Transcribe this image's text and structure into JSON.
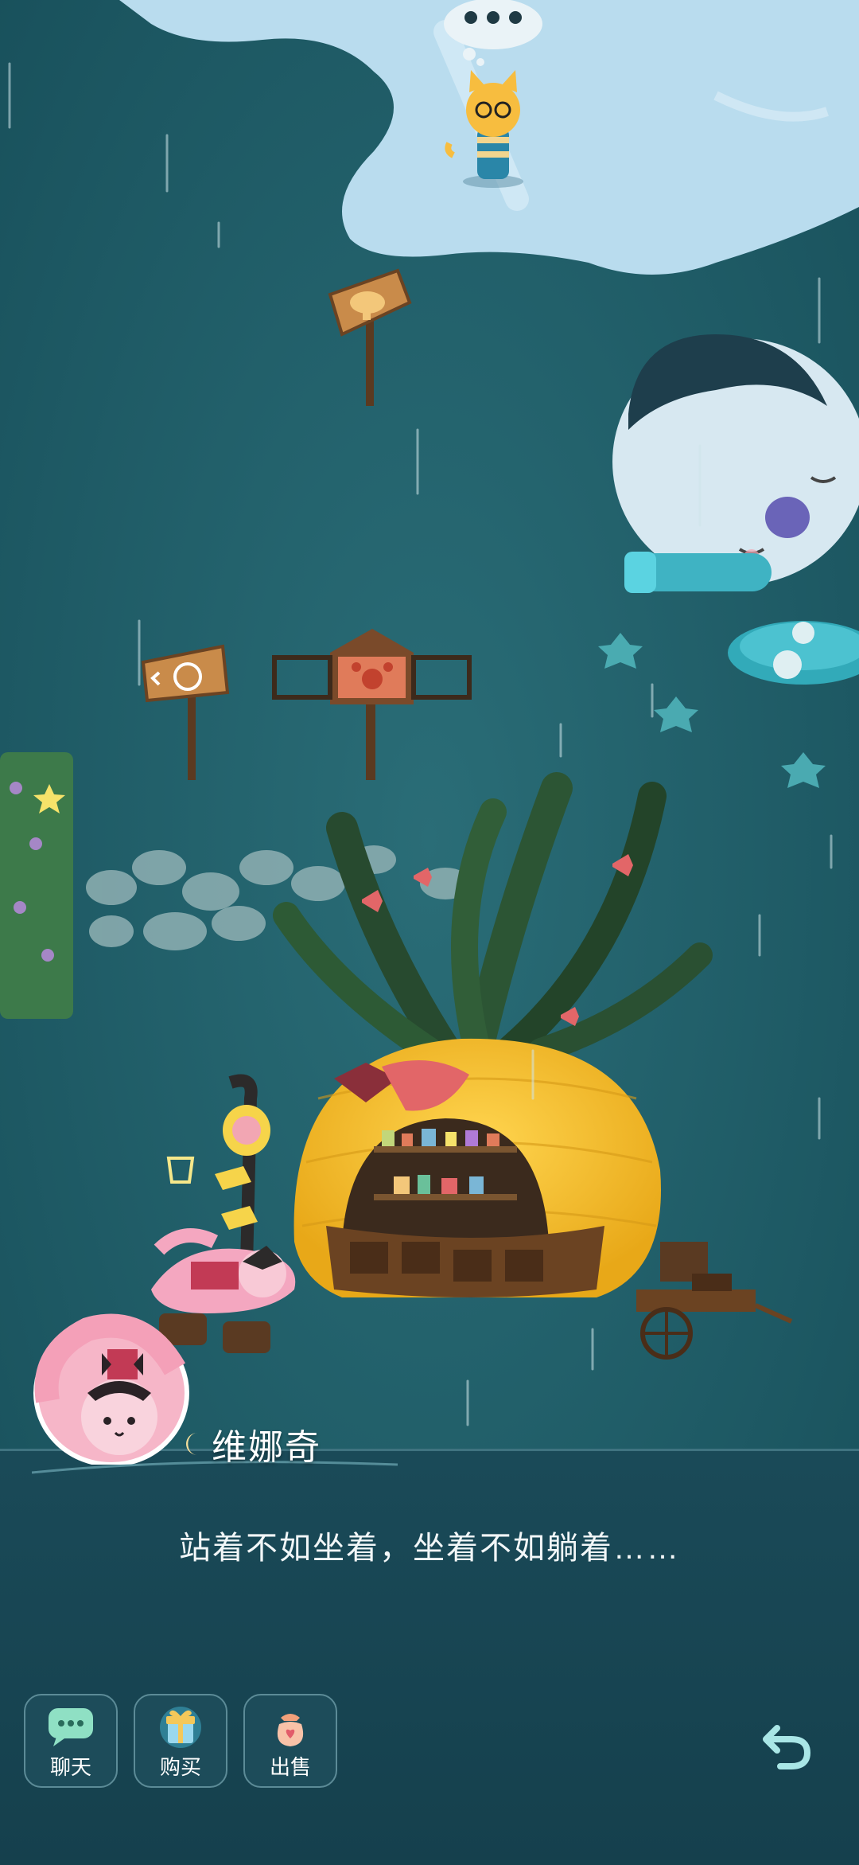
{
  "speaker": {
    "name": "维娜奇"
  },
  "dialog": {
    "text": "站着不如坐着，坐着不如躺着……"
  },
  "actions": [
    {
      "label": "聊天",
      "icon": "chat-bubble-icon"
    },
    {
      "label": "购买",
      "icon": "gift-icon"
    },
    {
      "label": "出售",
      "icon": "money-bag-icon"
    }
  ],
  "back": {
    "icon": "return-arrow-icon"
  },
  "colors": {
    "background": "#1f5a64",
    "dialog_bg": "#15404d",
    "text": "#ffffff"
  }
}
